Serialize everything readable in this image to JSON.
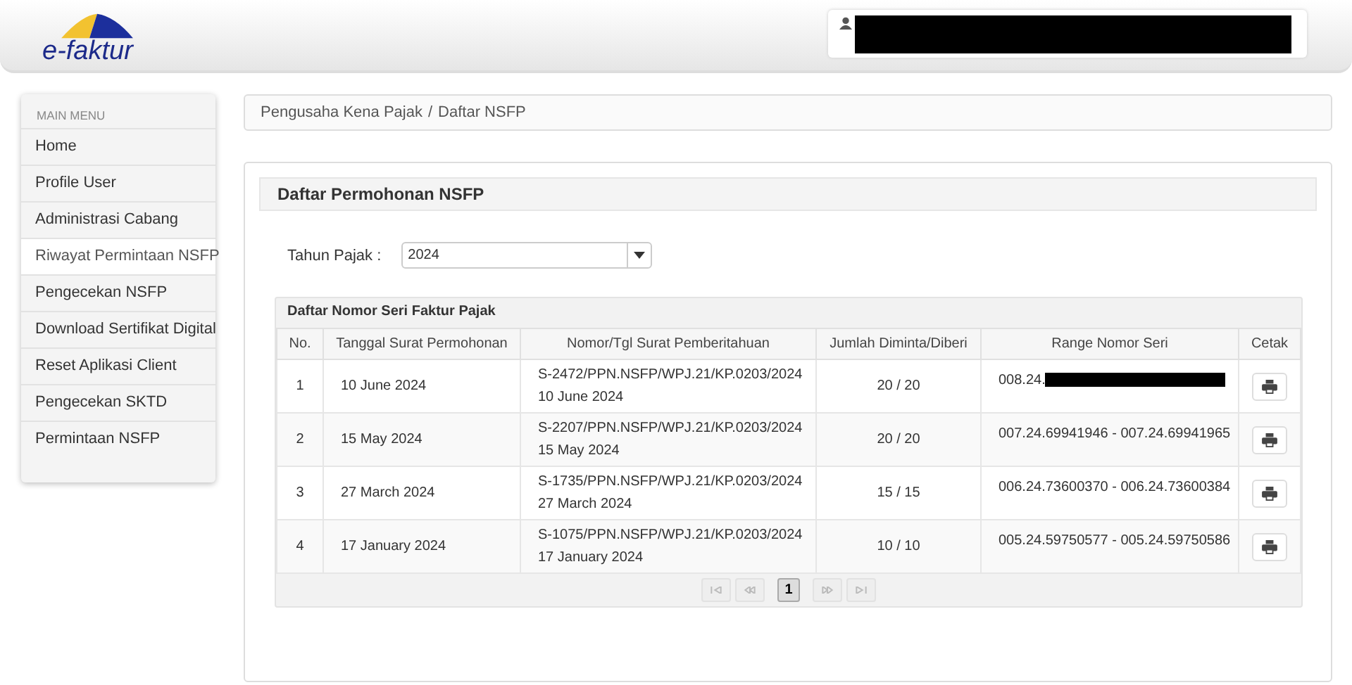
{
  "header": {
    "logo": "e-faktur",
    "user": {
      "redacted": true
    }
  },
  "sidebar": {
    "title": "MAIN MENU",
    "items": [
      {
        "label": "Home",
        "selected": false
      },
      {
        "label": "Profile User",
        "selected": false
      },
      {
        "label": "Administrasi Cabang",
        "selected": false
      },
      {
        "label": "Riwayat Permintaan NSFP",
        "selected": true
      },
      {
        "label": "Pengecekan NSFP",
        "selected": false
      },
      {
        "label": "Download Sertifikat Digital",
        "selected": false
      },
      {
        "label": "Reset Aplikasi Client",
        "selected": false
      },
      {
        "label": "Pengecekan SKTD",
        "selected": false
      },
      {
        "label": "Permintaan NSFP",
        "selected": false
      }
    ]
  },
  "breadcrumb": [
    "Pengusaha Kena Pajak",
    "Daftar NSFP"
  ],
  "breadcrumb_separator": "/",
  "panel": {
    "title": "Daftar Permohonan NSFP",
    "filter": {
      "label": "Tahun Pajak :",
      "value": "2024"
    },
    "table": {
      "caption": "Daftar Nomor Seri Faktur Pajak",
      "columns": [
        "No.",
        "Tanggal Surat Permohonan",
        "Nomor/Tgl Surat Pemberitahuan",
        "Jumlah Diminta/Diberi",
        "Range Nomor Seri",
        "Cetak"
      ],
      "rows": [
        {
          "no": "1",
          "tanggal": "10 June 2024",
          "nomor": "S-2472/PPN.NSFP/WPJ.21/KP.0203/2024",
          "tgl": "10 June 2024",
          "jumlah": "20 / 20",
          "range": "008.24.",
          "redacted": true
        },
        {
          "no": "2",
          "tanggal": "15 May 2024",
          "nomor": "S-2207/PPN.NSFP/WPJ.21/KP.0203/2024",
          "tgl": "15 May 2024",
          "jumlah": "20 / 20",
          "range": "007.24.69941946 - 007.24.69941965",
          "redacted": false
        },
        {
          "no": "3",
          "tanggal": "27 March 2024",
          "nomor": "S-1735/PPN.NSFP/WPJ.21/KP.0203/2024",
          "tgl": "27 March 2024",
          "jumlah": "15 / 15",
          "range": "006.24.73600370 - 006.24.73600384",
          "redacted": false
        },
        {
          "no": "4",
          "tanggal": "17 January 2024",
          "nomor": "S-1075/PPN.NSFP/WPJ.21/KP.0203/2024",
          "tgl": "17 January 2024",
          "jumlah": "10 / 10",
          "range": "005.24.59750577 - 005.24.59750586",
          "redacted": false
        }
      ]
    },
    "pager": {
      "pages": [
        {
          "label": "1",
          "selected": true
        }
      ],
      "first_disabled": true,
      "prev_disabled": true,
      "next_disabled": true,
      "last_disabled": true
    }
  }
}
